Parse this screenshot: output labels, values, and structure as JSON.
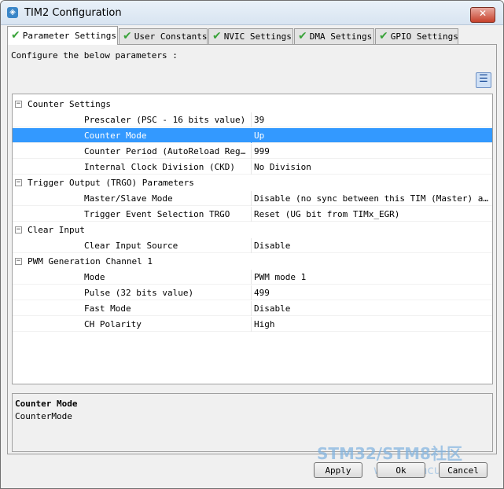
{
  "window": {
    "title": "TIM2 Configuration",
    "close_symbol": "✕"
  },
  "tabs": [
    {
      "label": "Parameter Settings",
      "active": true
    },
    {
      "label": "User Constants",
      "active": false
    },
    {
      "label": "NVIC Settings",
      "active": false
    },
    {
      "label": "DMA Settings",
      "active": false
    },
    {
      "label": "GPIO Settings",
      "active": false
    }
  ],
  "panel": {
    "instruction": "Configure the below parameters :",
    "view_icon": "list-view-icon"
  },
  "tree": {
    "groups": [
      {
        "name": "Counter Settings",
        "params": [
          {
            "name": "Prescaler (PSC - 16 bits value)",
            "value": "39"
          },
          {
            "name": "Counter Mode",
            "value": "Up",
            "selected": true
          },
          {
            "name": "Counter Period (AutoReload Regis...",
            "value": "999"
          },
          {
            "name": "Internal Clock Division (CKD)",
            "value": "No Division"
          }
        ]
      },
      {
        "name": "Trigger Output (TRGO) Parameters",
        "params": [
          {
            "name": "Master/Slave Mode",
            "value": "Disable (no sync between this TIM (Master) and ..."
          },
          {
            "name": "Trigger Event Selection TRGO",
            "value": "Reset (UG bit from TIMx_EGR)"
          }
        ]
      },
      {
        "name": "Clear Input",
        "params": [
          {
            "name": "Clear Input Source",
            "value": "Disable"
          }
        ]
      },
      {
        "name": "PWM Generation Channel 1",
        "params": [
          {
            "name": "Mode",
            "value": "PWM mode 1"
          },
          {
            "name": "Pulse (32 bits value)",
            "value": "499"
          },
          {
            "name": "Fast Mode",
            "value": "Disable"
          },
          {
            "name": "CH Polarity",
            "value": "High"
          }
        ]
      }
    ]
  },
  "description": {
    "title": "Counter Mode",
    "text": "CounterMode"
  },
  "buttons": {
    "apply": "Apply",
    "ok": "Ok",
    "cancel": "Cancel"
  },
  "watermark": {
    "line1": "STM32/STM8社区",
    "line2": "www.stmcu.org"
  },
  "colors": {
    "selection": "#3399ff",
    "check": "#3aa33a"
  }
}
